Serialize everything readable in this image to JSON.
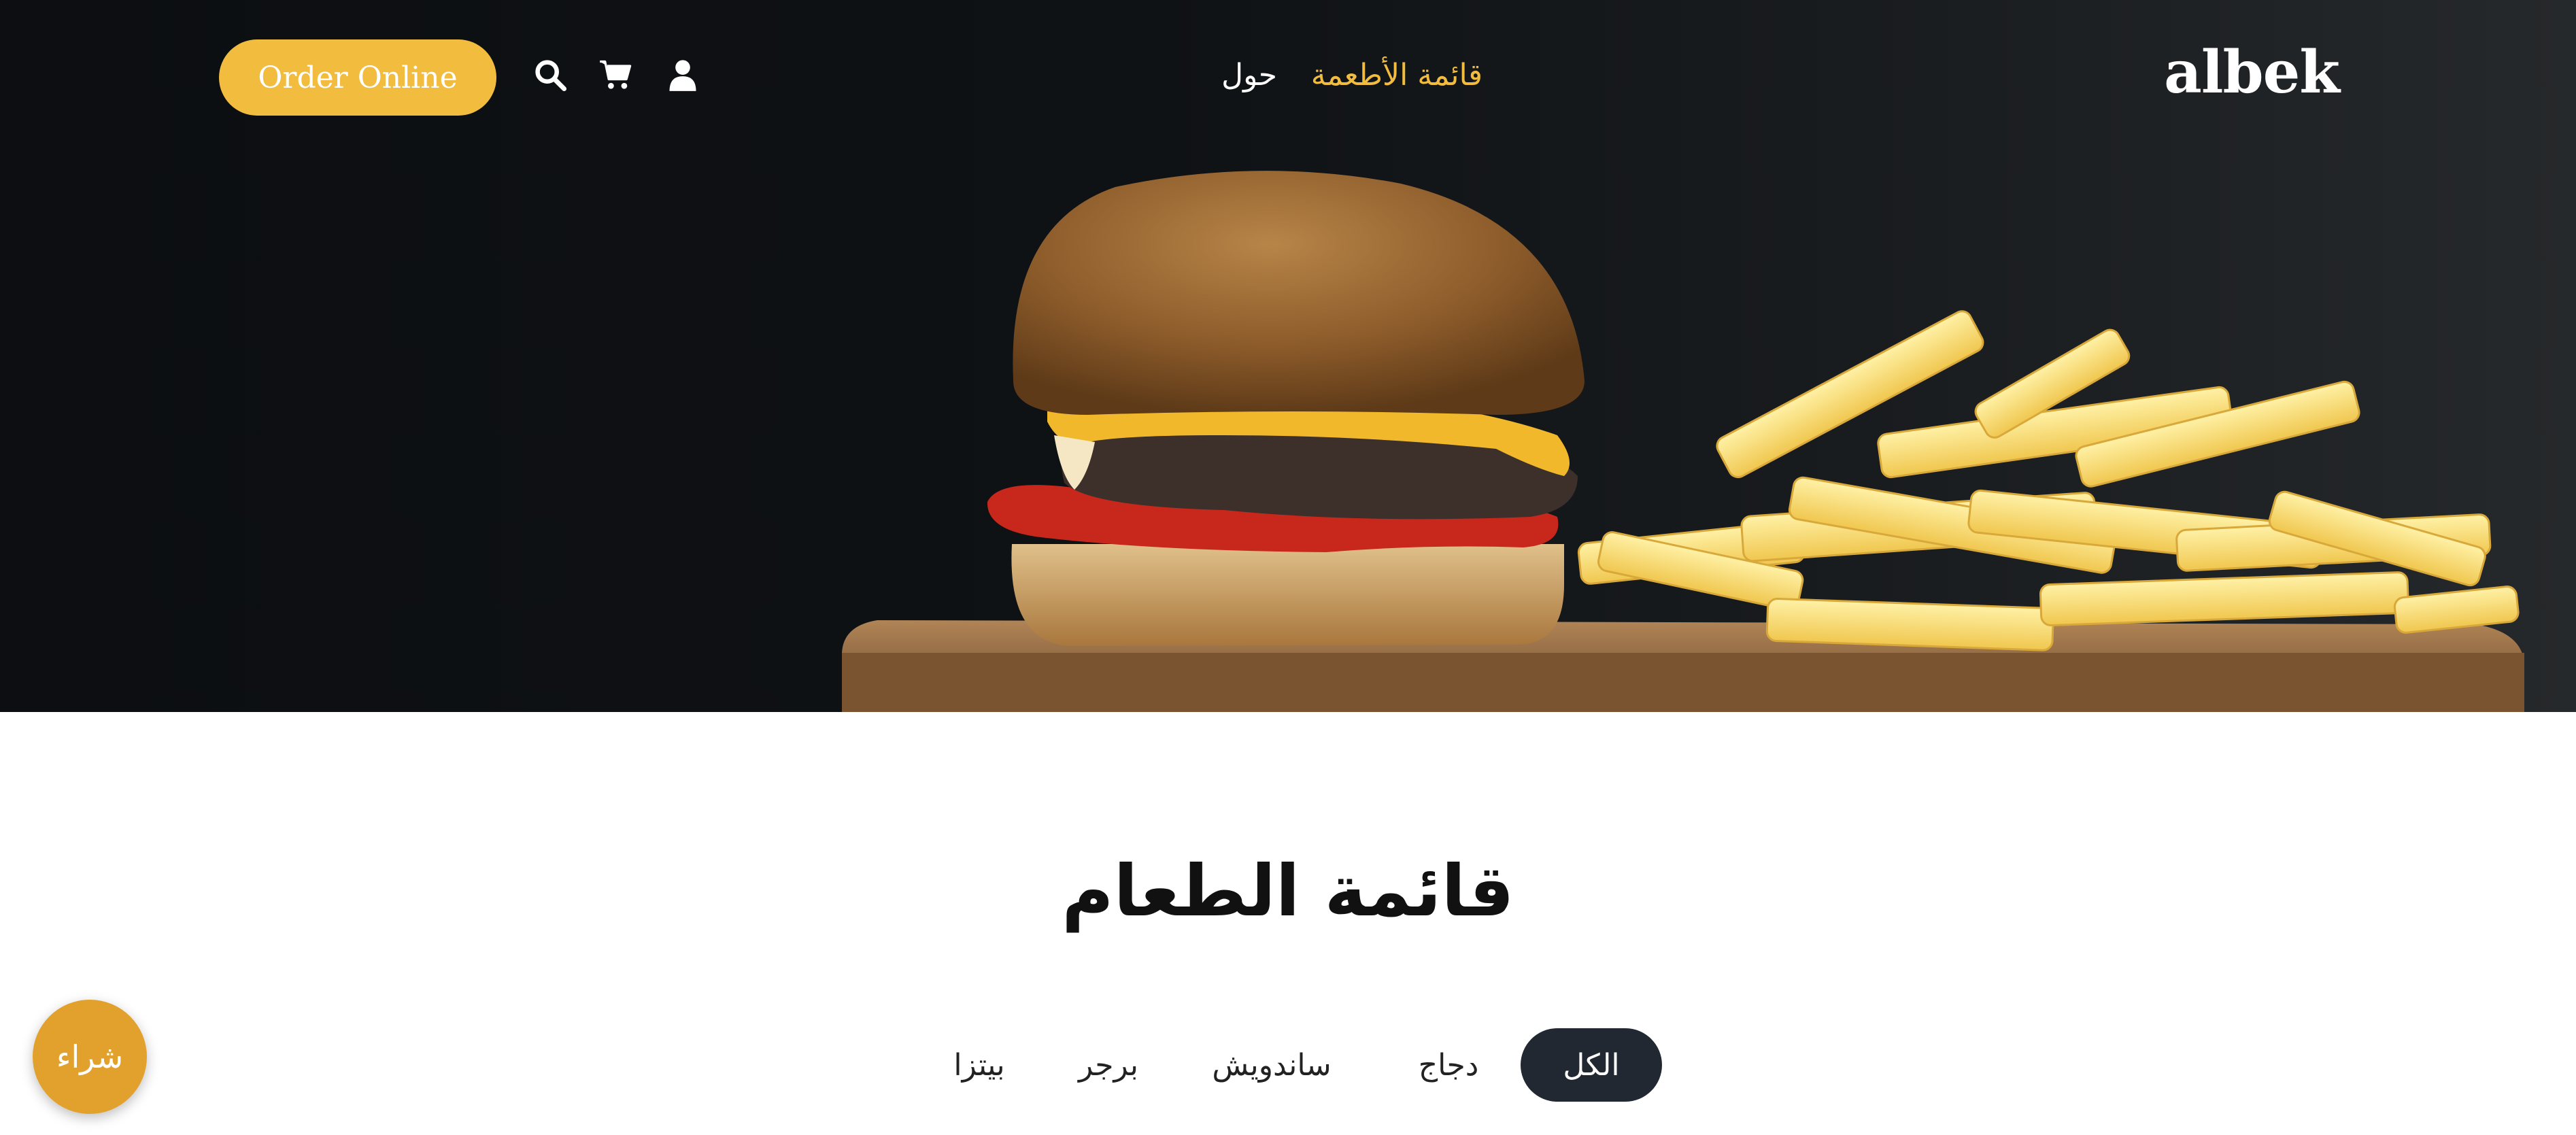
{
  "header": {
    "order_button_label": "Order Online",
    "logo_text": "albek",
    "nav_links": [
      {
        "label": "قائمة الأطعمة",
        "active": true
      },
      {
        "label": "حول",
        "active": false
      }
    ],
    "icons": [
      "search-icon",
      "cart-icon",
      "user-icon"
    ]
  },
  "hero": {
    "image": "burger-and-fries-photo"
  },
  "menu_section": {
    "title": "قائمة الطعام",
    "filters": [
      {
        "label": "الكل",
        "active": true
      },
      {
        "label": "دجاج",
        "active": false
      },
      {
        "label": "ساندويش",
        "active": false
      },
      {
        "label": "برجر",
        "active": false
      },
      {
        "label": "بيتزا",
        "active": false
      }
    ]
  },
  "floating": {
    "buy_label": "شراء"
  },
  "colors": {
    "accent": "#f2bd3f",
    "buy_button": "#e2a12d",
    "active_filter": "#222831",
    "hero_background": "#0f1215"
  }
}
